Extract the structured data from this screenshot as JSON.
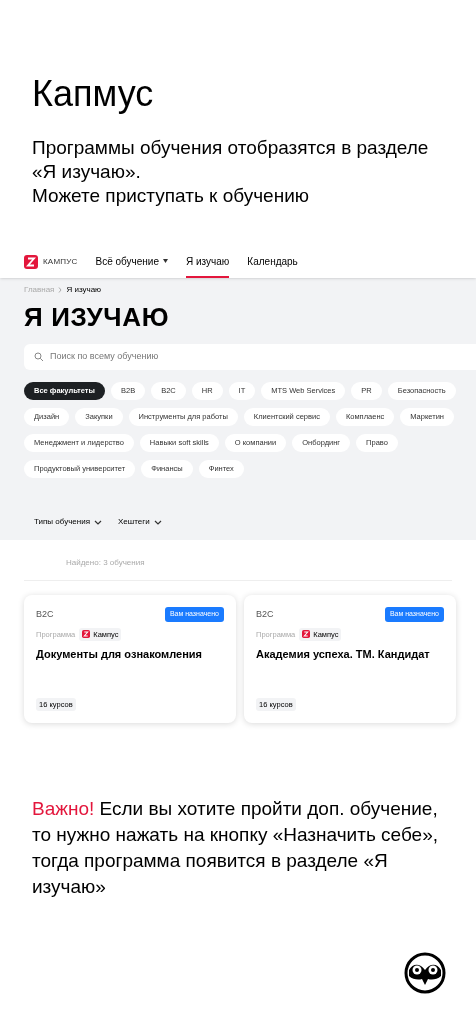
{
  "slide_title": "Капмус",
  "intro_lines": [
    "Программы обучения отобразятся в разделе «Я изучаю».",
    "Можете приступать к обучению"
  ],
  "screen": {
    "logo_text": "КАМПУС",
    "nav": [
      {
        "label": "Всё обучение",
        "dropdown": true,
        "selected": false
      },
      {
        "label": "Я изучаю",
        "dropdown": false,
        "selected": true
      },
      {
        "label": "Календарь",
        "dropdown": false,
        "selected": false
      }
    ],
    "breadcrumb": [
      "Главная",
      "Я изучаю"
    ],
    "heading": "Я ИЗУЧАЮ",
    "search": {
      "placeholder": "Поиск по всему обучению"
    },
    "chip_rows": [
      [
        {
          "label": "Все факультеты",
          "selected": true
        },
        {
          "label": "B2B",
          "selected": false
        },
        {
          "label": "B2C",
          "selected": false
        },
        {
          "label": "HR",
          "selected": false
        },
        {
          "label": "IT",
          "selected": false
        },
        {
          "label": "MTS Web Services",
          "selected": false
        },
        {
          "label": "PR",
          "selected": false
        },
        {
          "label": "Безопасность",
          "selected": false
        }
      ],
      [
        {
          "label": "Дизайн",
          "selected": false
        },
        {
          "label": "Закупки",
          "selected": false
        },
        {
          "label": "Инструменты для работы",
          "selected": false
        },
        {
          "label": "Клиентский сервис",
          "selected": false
        },
        {
          "label": "Комплаенс",
          "selected": false
        },
        {
          "label": "Маркетин",
          "selected": false
        }
      ],
      [
        {
          "label": "Менеджмент и лидерство",
          "selected": false
        },
        {
          "label": "Навыки soft skills",
          "selected": false
        },
        {
          "label": "О компании",
          "selected": false
        },
        {
          "label": "Онбординг",
          "selected": false
        },
        {
          "label": "Право",
          "selected": false
        }
      ],
      [
        {
          "label": "Продуктовый университет",
          "selected": false
        },
        {
          "label": "Финансы",
          "selected": false
        },
        {
          "label": "Финтех",
          "selected": false
        }
      ]
    ],
    "filters": [
      "Типы обучения",
      "Хештеги"
    ],
    "found": "Найдено: 3 обучения",
    "cards": [
      {
        "category": "B2C",
        "badge": "Вам назначено",
        "type": "Программа",
        "source": "Кампус",
        "title": "Документы для ознакомления",
        "count": "16 курсов"
      },
      {
        "category": "B2C",
        "badge": "Вам назначено",
        "type": "Программа",
        "source": "Кампус",
        "title": "Академия успеха. ТМ. Кандидат",
        "count": "16 курсов"
      }
    ]
  },
  "important_label": "Важно!",
  "important_text": "Если вы хотите пройти доп. обучение, то нужно нажать на кнопку «Назначить себе», тогда программа появится в разделе «Я изучаю»"
}
